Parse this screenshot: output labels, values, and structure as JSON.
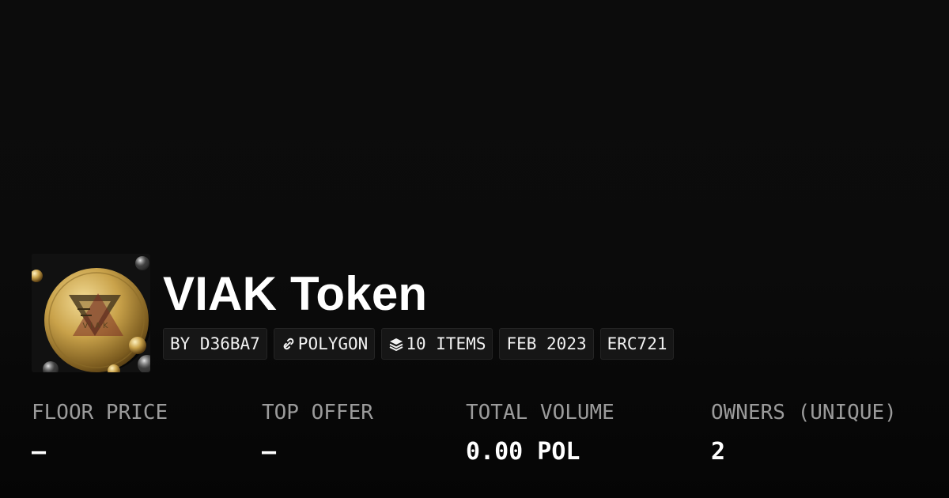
{
  "collection": {
    "name": "VIAK Token",
    "image_icon": "viak-gold-coin-logo"
  },
  "tags": [
    {
      "label": "BY D36BA7",
      "icon": null
    },
    {
      "label": "POLYGON",
      "icon": "polygon-link-icon"
    },
    {
      "label": "10 ITEMS",
      "icon": "layers-icon"
    },
    {
      "label": "FEB 2023",
      "icon": null
    },
    {
      "label": "ERC721",
      "icon": null
    }
  ],
  "stats": [
    {
      "label": "FLOOR PRICE",
      "value": "–"
    },
    {
      "label": "TOP OFFER",
      "value": "–"
    },
    {
      "label": "TOTAL VOLUME",
      "value": "0.00 POL"
    },
    {
      "label": "OWNERS (UNIQUE)",
      "value": "2"
    }
  ],
  "colors": {
    "background": "#0b0b0b",
    "text_primary": "#ffffff",
    "text_muted": "#9b9b9b",
    "tag_background": "#161616",
    "coin_gold": "#c9a24a"
  }
}
